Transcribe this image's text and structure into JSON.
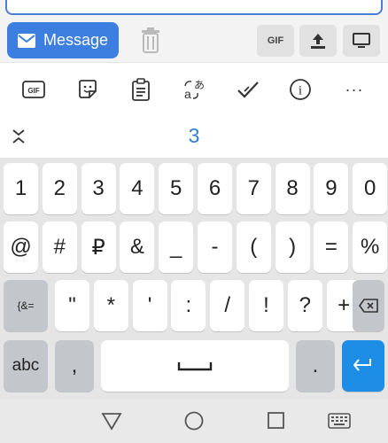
{
  "composer": {
    "message_label": "Message",
    "gif_label": "GIF"
  },
  "toolbar": {
    "items": [
      {
        "name": "gif-icon",
        "label": "GIF"
      },
      {
        "name": "sticker-icon"
      },
      {
        "name": "clipboard-icon"
      },
      {
        "name": "translate-icon",
        "label": "あ"
      },
      {
        "name": "checkmark-icon"
      },
      {
        "name": "info-icon",
        "label": "i"
      },
      {
        "name": "more-icon",
        "label": "···"
      }
    ]
  },
  "suggestion": {
    "text": "3"
  },
  "keyboard": {
    "row1": [
      "1",
      "2",
      "3",
      "4",
      "5",
      "6",
      "7",
      "8",
      "9",
      "0"
    ],
    "row2": [
      "@",
      "#",
      "₽",
      "&",
      "_",
      "-",
      "(",
      ")",
      "=",
      "%"
    ],
    "row3": {
      "mode": "{&=",
      "keys": [
        "\"",
        "*",
        "'",
        ":",
        "/",
        "!",
        "?",
        "+"
      ]
    },
    "row4": {
      "abc": "abc",
      "comma": ",",
      "period": "."
    }
  },
  "colors": {
    "accent": "#3d7fe0",
    "suggestion": "#2e7fcf",
    "enter_key": "#1e8de6",
    "keyboard_bg": "#e5e5e5"
  }
}
